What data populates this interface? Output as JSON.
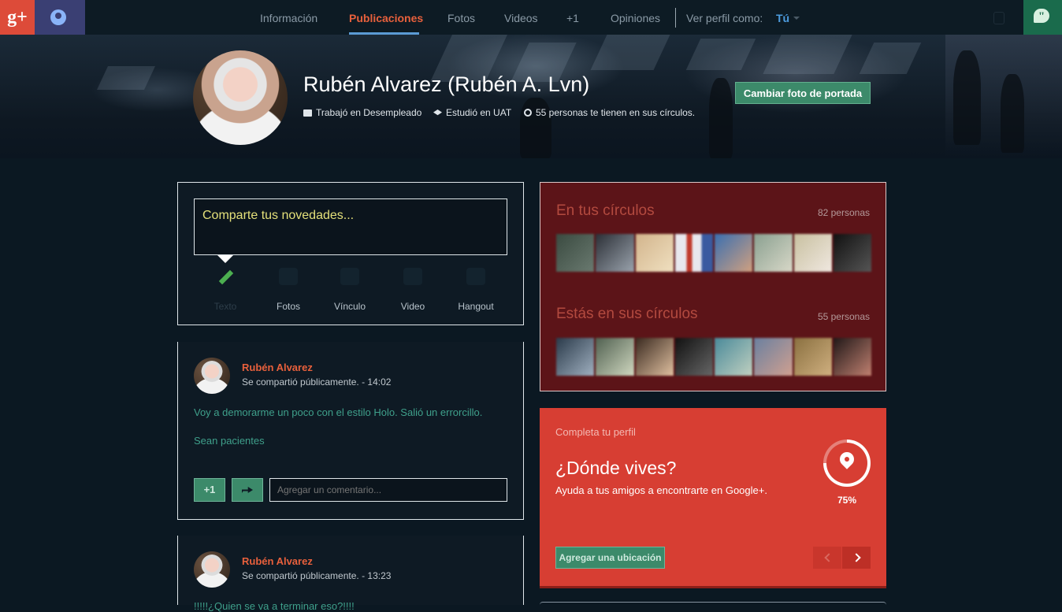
{
  "topbar": {
    "logo": "g+",
    "nav": [
      {
        "label": "Información",
        "active": false
      },
      {
        "label": "Publicaciones",
        "active": true
      },
      {
        "label": "Fotos",
        "active": false
      },
      {
        "label": "Videos",
        "active": false
      },
      {
        "label": "+1",
        "active": false
      },
      {
        "label": "Opiniones",
        "active": false
      }
    ],
    "view_as_label": "Ver perfil como:",
    "view_as_value": "Tú",
    "accent": "#e8603c"
  },
  "profile": {
    "name": "Rubén Alvarez (Rubén A. Lvn)",
    "work": "Trabajó en Desempleado",
    "education": "Estudió en UAT",
    "circles": "55 personas te tienen en sus círculos.",
    "cover_button": "Cambiar foto de portada"
  },
  "share": {
    "placeholder": "Comparte tus novedades...",
    "options": [
      {
        "label": "Texto",
        "icon": "pencil-icon"
      },
      {
        "label": "Fotos",
        "icon": "camera-icon"
      },
      {
        "label": "Vínculo",
        "icon": "link-icon"
      },
      {
        "label": "Video",
        "icon": "video-icon"
      },
      {
        "label": "Hangout",
        "icon": "hangout-icon"
      }
    ]
  },
  "posts": [
    {
      "author": "Rubén Alvarez",
      "meta": "Se compartió públicamente.  -  14:02",
      "lines": [
        "Voy a demorarme un poco con el estilo Holo. Salió un errorcillo.",
        "Sean pacientes"
      ],
      "plus_label": "+1",
      "comment_placeholder": "Agregar un comentario..."
    },
    {
      "author": "Rubén Alvarez",
      "meta": "Se compartió públicamente.  -  13:23",
      "lines": [
        "!!!!!¿Quien se va a terminar eso?!!!!"
      ]
    }
  ],
  "circles": {
    "in_your_circles": {
      "title": "En tus círculos",
      "count": "82 personas"
    },
    "in_their_circles": {
      "title": "Estás en sus círculos",
      "count": "55 personas"
    }
  },
  "complete_profile": {
    "label": "Completa tu perfil",
    "question": "¿Dónde vives?",
    "hint": "Ayuda a tus amigos a encontrarte en Google+.",
    "progress_percent": 75,
    "progress_label": "75%",
    "button": "Agregar una ubicación"
  }
}
